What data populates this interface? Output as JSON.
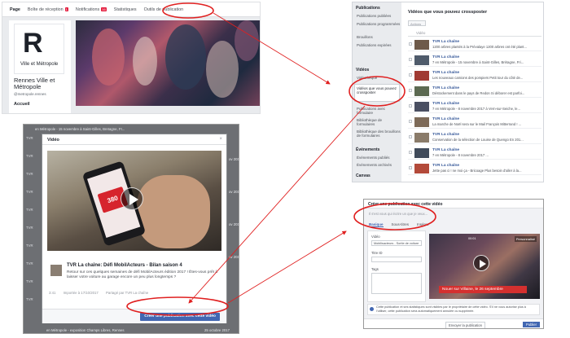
{
  "fb_page": {
    "tabs": [
      {
        "label": "Page",
        "active": true
      },
      {
        "label": "Boîte de réception",
        "badge": "1"
      },
      {
        "label": "Notifications",
        "badge": "16"
      },
      {
        "label": "Statistiques"
      },
      {
        "label": "Outils de publication"
      }
    ],
    "logo_letter": "R",
    "logo_text": "Ville et Métropole",
    "page_name": "Rennes Ville et Métropole",
    "handle": "@metropole.rennes",
    "nav_home": "Accueil"
  },
  "publications": {
    "sidebar": {
      "heading_publications": "Publications",
      "items": [
        "Publications publiées",
        "Publications programmées",
        "Brouillons",
        "Publications expirées"
      ],
      "heading_videos": "Vidéos",
      "video_items": [
        "Vidéothèque",
        "Vidéos que vous pouvez crossposter"
      ],
      "more_items": [
        "Publications avec formulaire",
        "Bibliothèque de formulaires",
        "Bibliothèque des brouillons de formulaires"
      ],
      "heading_events": "Événements",
      "event_items": [
        "Événements publiés",
        "Événements archivés"
      ],
      "heading_canvas": "Canvas"
    },
    "title": "Vidéos que vous pouvez crossposter",
    "actions_label": "Actions",
    "column_header": "Vidéo",
    "rows": [
      {
        "title": "TVR La chaîne",
        "desc": "1200 arbres plantés à la Prévalaye 1200 arbres ont été plant...",
        "color": "#6e5a4a"
      },
      {
        "title": "TVR La chaîne",
        "desc": "7 en Métropole - 15 novembre à Saint-Gilles, Brétagne, Fri...",
        "color": "#4f5b6b"
      },
      {
        "title": "TVR La chaîne",
        "desc": "Les nouveaux camions des pompiers Petit tour du côté de...",
        "color": "#a03a33"
      },
      {
        "title": "TVR La chaîne",
        "desc": "Déstockement dans le pays de Redon Si déborer est parfoi...",
        "color": "#5c6a52"
      },
      {
        "title": "TVR La chaîne",
        "desc": "7 en Métropole - 8 novembre 2017 à Vern-sur-Seiche, le...",
        "color": "#4a4f62"
      },
      {
        "title": "TVR La chaîne",
        "desc": "La marche de Noël sera sur le Mail François Mitterrand ! ...",
        "color": "#7d6a58"
      },
      {
        "title": "TVR La chaîne",
        "desc": "Conservation de la sélection de Louise de Quengo En 201...",
        "color": "#8a7b69"
      },
      {
        "title": "TVR La chaîne",
        "desc": "7 en Métropole - 8 novembre 2017 ...",
        "color": "#3f4a5a"
      },
      {
        "title": "TVR La chaîne",
        "desc": "Jette pas ci ! ne moi ça - Bricoage Plus besoin d'aller à la...",
        "color": "#b34a3a"
      }
    ]
  },
  "video_modal": {
    "bg_top": "en Métropole - 15 novembre à Saint-Gilles, Bretagne, Fr...",
    "bg_bottom": "en Métropole - exposition Champs Libres, Rennes",
    "bg_strip": [
      "TVR",
      "TVR",
      "TVR",
      "TVR",
      "TVR",
      "TVR",
      "TVR",
      "TVR",
      "TVR",
      "TVR"
    ],
    "bg_dates": [
      "ov 2017",
      "ov 2017",
      "ov 2017",
      "ov 2017",
      "25 octobre 2017"
    ],
    "header": "Vidéo",
    "close": "×",
    "phone_number": "380",
    "video_title": "TVR La chaîne: Défi MobilActeurs - Bilan saison 4",
    "video_desc": "Retour sur ces quelques semaines de défi MobilActeurs édition 2017 ! Êtes-vous prêt à laisser votre voiture au garage encore un peu plus longtemps ?",
    "duration": "3:41",
    "imported": "Importée à 17/10/2017",
    "shared_by": "Partagé par TVR La chaîne",
    "button": "Créer une publication avec cette vidéo"
  },
  "create_post": {
    "title": "Créer une publication avec cette vidéo",
    "subtitle": "Il s'est vous qui écrire un que je veux...",
    "tabs": [
      "Basique",
      "Sous-titres",
      "Insérez"
    ],
    "label_video": "Vidéo",
    "video_field": "Mobilisacteurs - Sortie de voiture",
    "label_desc": "Titre ID",
    "label_tags": "Tags",
    "time": "00:01",
    "perso": "Personnalisé",
    "caption": "Nouer sur Villaine, le 26 septembre",
    "note": "Cette publication et ses statistiques sont visibles par le propriétaire de cette vidéo. S'il ne vous autorise plus à l'utiliser, cette publication sera automatiquement annulée ou supprimée.",
    "footer_a": "Envoyer la publication",
    "footer_pub": "Publier"
  },
  "colors": {
    "accent_blue": "#4267b2",
    "annotation_red": "#e02020",
    "fb_bg": "#e9ebee"
  }
}
